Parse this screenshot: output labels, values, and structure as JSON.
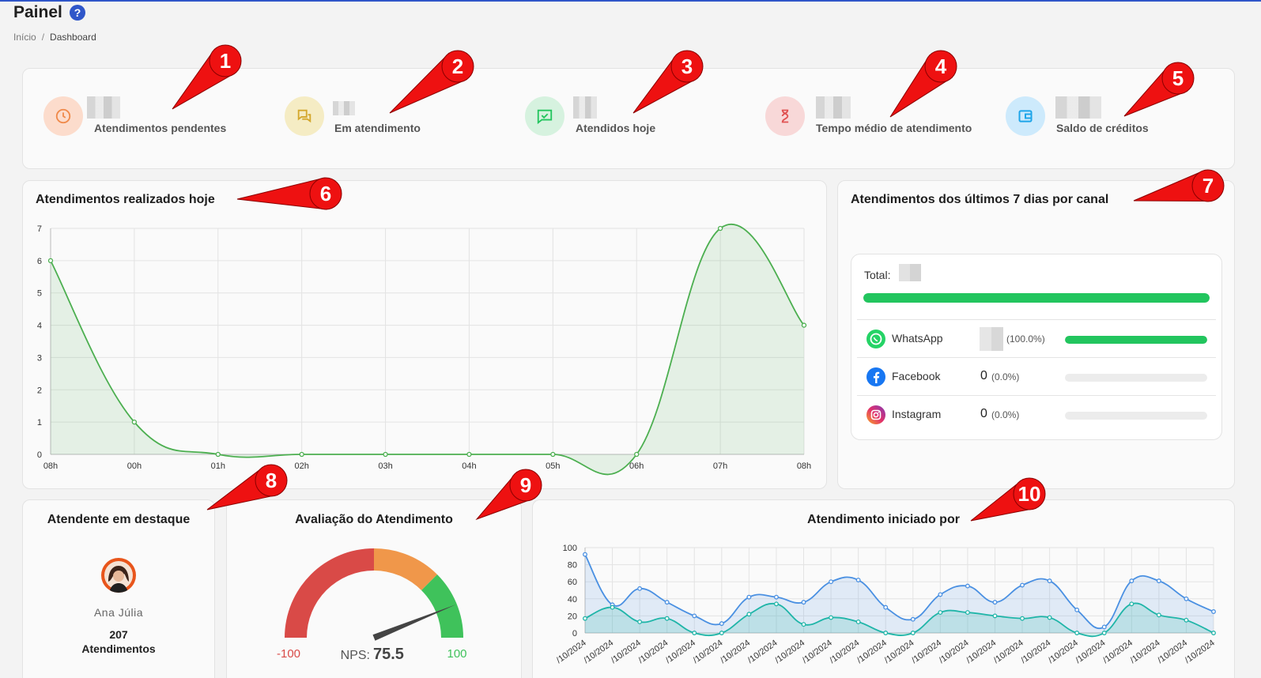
{
  "header": {
    "title": "Painel",
    "help": "?",
    "breadcrumb": {
      "home": "Início",
      "separator": "/",
      "current": "Dashboard"
    }
  },
  "stats": [
    {
      "label": "Atendimentos pendentes",
      "icon": "clock-icon",
      "color": "#f08a4b",
      "bg": "#fcdccc"
    },
    {
      "label": "Em atendimento",
      "icon": "chat-icon",
      "color": "#d4a72c",
      "bg": "#f5ecc4"
    },
    {
      "label": "Atendidos hoje",
      "icon": "message-check-icon",
      "color": "#22c55e",
      "bg": "#d6f2df"
    },
    {
      "label": "Tempo médio de atendimento",
      "icon": "hourglass-icon",
      "color": "#e05252",
      "bg": "#f8d8d8"
    },
    {
      "label": "Saldo de créditos",
      "icon": "wallet-icon",
      "color": "#1ea5e9",
      "bg": "#cdeafc"
    }
  ],
  "today_chart": {
    "title": "Atendimentos realizados hoje",
    "chart_data": {
      "type": "area",
      "categories": [
        "08h",
        "00h",
        "01h",
        "02h",
        "03h",
        "04h",
        "05h",
        "06h",
        "07h",
        "08h"
      ],
      "values": [
        6,
        1,
        0,
        0,
        0,
        0,
        0,
        0,
        7,
        4
      ],
      "ylim": [
        0,
        7
      ],
      "yticks": [
        "0",
        "1",
        "2",
        "3",
        "4",
        "5",
        "6",
        "7"
      ],
      "grid": true,
      "color": "#4caf50"
    }
  },
  "channels": {
    "title": "Atendimentos dos últimos 7 dias por canal",
    "total_label": "Total:",
    "total_bar_pct": 100,
    "items": [
      {
        "name": "WhatsApp",
        "count": "",
        "pct": "(100.0%)",
        "fill": 100,
        "color": "#25d366"
      },
      {
        "name": "Facebook",
        "count": "0",
        "pct": "(0.0%)",
        "fill": 0,
        "color": "#1877f2"
      },
      {
        "name": "Instagram",
        "count": "0",
        "pct": "(0.0%)",
        "fill": 0,
        "color": "#d6249f"
      }
    ]
  },
  "highlight": {
    "title": "Atendente em destaque",
    "name": "Ana Júlia",
    "count": "207",
    "count_label": "Atendimentos"
  },
  "nps": {
    "title": "Avaliação do Atendimento",
    "min": "-100",
    "max": "100",
    "label": "NPS:",
    "value": "75.5",
    "value_num": 75.5
  },
  "initiated": {
    "title": "Atendimento iniciado por",
    "chart_data": {
      "type": "area",
      "x_label_fragment": "/10/2024",
      "x_count": 24,
      "ylim": [
        0,
        100
      ],
      "yticks": [
        "0",
        "20",
        "40",
        "60",
        "80",
        "100"
      ],
      "grid": true,
      "series": [
        {
          "values": [
            92,
            33,
            52,
            36,
            20,
            11,
            42,
            42,
            36,
            60,
            62,
            30,
            16,
            45,
            55,
            36,
            56,
            61,
            27,
            7,
            61,
            61,
            40,
            25
          ],
          "color": "#4a90e2"
        },
        {
          "values": [
            17,
            30,
            13,
            17,
            0,
            0,
            22,
            34,
            10,
            18,
            13,
            0,
            0,
            24,
            24,
            20,
            17,
            18,
            0,
            0,
            34,
            21,
            15,
            0
          ],
          "color": "#1fb5a8"
        }
      ]
    }
  },
  "annotations": [
    "1",
    "2",
    "3",
    "4",
    "5",
    "6",
    "7",
    "8",
    "9",
    "10"
  ]
}
